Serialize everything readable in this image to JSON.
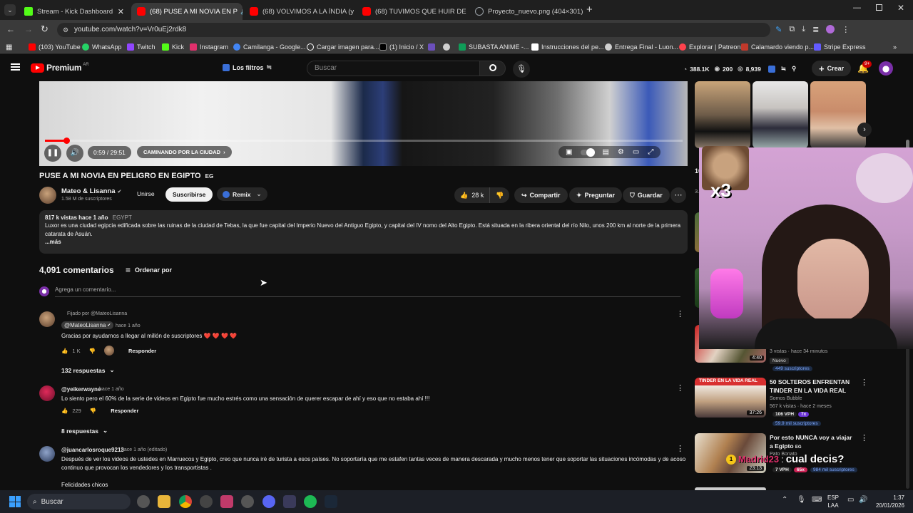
{
  "browser": {
    "tabs": [
      {
        "title": "Stream - Kick Dashboard",
        "icon": "kick-icon",
        "color": "#53fc18"
      },
      {
        "title": "(68) PUSE A MI NOVIA EN P",
        "icon": "youtube-icon",
        "color": "#ff0000",
        "active": true
      },
      {
        "title": "(68) VOLVIMOS A LA ÍNDIA (y",
        "icon": "youtube-icon",
        "color": "#ff0000"
      },
      {
        "title": "(68) TUVIMOS QUE HUIR DE IN",
        "icon": "youtube-icon",
        "color": "#ff0000"
      },
      {
        "title": "Proyecto_nuevo.png (404×301)",
        "icon": "globe-icon",
        "color": "#9aa0a6"
      }
    ],
    "url": "youtube.com/watch?v=Vr0uEj2rdk8",
    "bookmarks": [
      {
        "label": "(103) YouTube",
        "color": "#ff0000"
      },
      {
        "label": "WhatsApp",
        "color": "#25d366"
      },
      {
        "label": "Twitch",
        "color": "#9146ff"
      },
      {
        "label": "Kick",
        "color": "#53fc18"
      },
      {
        "label": "Instagram",
        "color": "#e1306c"
      },
      {
        "label": "Camilanga - Google...",
        "color": "#4285f4"
      },
      {
        "label": "Cargar imagen para...",
        "color": "#ffffff"
      },
      {
        "label": "(1) Inicio / X",
        "color": "#000000"
      },
      {
        "label": "",
        "color": "#6b4fbb"
      },
      {
        "label": "",
        "color": "#cfcfcf"
      },
      {
        "label": "SUBASTA ANIME -...",
        "color": "#0f9d58"
      },
      {
        "label": "Instrucciones del pe...",
        "color": "#ffffff"
      },
      {
        "label": "Entrega Final - Luon...",
        "color": "#cfcfcf"
      },
      {
        "label": "Explorar | Patreon",
        "color": "#ff424d"
      },
      {
        "label": "Calamardo viendo p...",
        "color": "#c0392b"
      },
      {
        "label": "Stripe Express",
        "color": "#635bff"
      }
    ]
  },
  "youtube": {
    "logo": "Premium",
    "logo_region": "AR",
    "filters_label": "Los filtros",
    "search_placeholder": "Buscar",
    "stats": {
      "views": "388.1K",
      "count2": "200",
      "count3": "8,939"
    },
    "create_label": "Crear",
    "notifications": "9+"
  },
  "player": {
    "time": "0:59 / 29:51",
    "chapter": "CAMINANDO POR LA CIUDAD",
    "progress": 0.033
  },
  "video": {
    "title": "PUSE A MI NOVIA EN PELIGRO EN EGIPTO",
    "title_flag": "EG",
    "channel": "Mateo & Lisanna",
    "subscribers": "1.58 M de suscriptores",
    "join_label": "Unirse",
    "subscribe_label": "Suscribirse",
    "remix_label": "Remix",
    "likes": "28 k",
    "share_label": "Compartir",
    "ask_label": "Preguntar",
    "save_label": "Guardar",
    "views_line": "817 k vistas  hace 1 año",
    "location": "EGYPT",
    "description": "Luxor es una ciudad egipcia edificada sobre las ruinas de la ciudad de Tebas, la que fue capital del Imperio Nuevo del Antiguo Egipto, y capital del IV nomo del Alto Egipto. Está situada en la ribera oriental del río Nilo, unos 200 km al norte de la primera catarata de Asuán.",
    "more": "...más"
  },
  "comments": {
    "count": "4,091 comentarios",
    "sort_label": "Ordenar por",
    "add_placeholder": "Agrega un comentario...",
    "items": [
      {
        "pinned": "Fijado por @MateoLisanna",
        "author": "@MateoLisanna",
        "time": "hace 1 año",
        "text": "Gracias por ayudarnos a llegar al millón de suscriptores ❤️ ❤️ ❤️ ❤️",
        "likes": "1 K",
        "reply": "Responder",
        "replies": "132 respuestas"
      },
      {
        "author": "@yeikerwayne",
        "time": "hace 1 año",
        "text": "Lo siento pero el 60% de la serie de videos en Egipto fue mucho estrés como una sensación de querer escapar de ahí y eso que no estaba ahí !!!",
        "likes": "229",
        "reply": "Responder",
        "replies": "8 respuestas"
      },
      {
        "author": "@juancarlosroque9213",
        "time": "hace 1 año (editado)",
        "text": "Después de ver los videos de ustedes en Marruecos y Egipto, creo que nunca iré de turista a esos países. No soportaría que me estafen tantas veces de manera descarada y mucho menos tener que soportar las situaciones incómodas y de acoso continuo que provocan  los vendedores y los transportistas .",
        "extra": "Felicidades chicos"
      }
    ]
  },
  "sidebar": {
    "partial_title": "10",
    "partial_meta": "3.4",
    "items": [
      {
        "meta1": "3 vistas · hace 34 minutos",
        "badge": "Nuevo",
        "sub": "449 suscriptores",
        "duration": "4:40"
      },
      {
        "title": "50 SOLTEROS ENFRENTAN TINDER EN LA VIDA REAL",
        "thumb_text": "TINDER EN LA VIDA REAL",
        "channel": "Somos Bubble",
        "meta": "567 k vistas · hace 2 meses",
        "vph": "106 VPH",
        "multiplier": "7x",
        "sub": "59.9 mil suscriptores",
        "duration": "37:26"
      },
      {
        "title": "Por esto NUNCA voy a viajar a Egipto",
        "title_flag": "EG",
        "channel": "Pato Bonato",
        "vph": "7 VPH",
        "multiplier": "65x",
        "sub": "984 mil suscriptores",
        "duration": "23:13"
      }
    ]
  },
  "overlay": {
    "multiplier": "x3",
    "chat_text": "cual decis?",
    "chat_user": "Madrid23"
  },
  "taskbar": {
    "search_placeholder": "Buscar",
    "lang1": "ESP",
    "lang2": "LAA",
    "time": "1:37",
    "date": "20/01/2026"
  }
}
